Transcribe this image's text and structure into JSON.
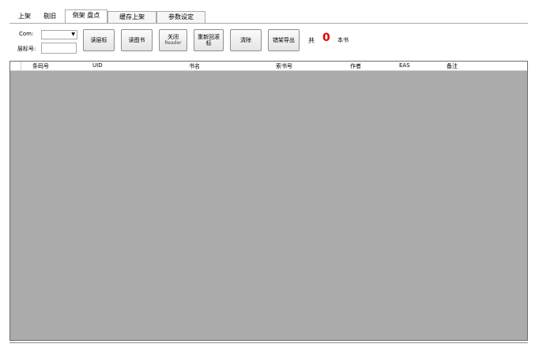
{
  "tabs": [
    "上架",
    "剔旧",
    "倒架 盘点",
    "缓存上架",
    "参数设定"
  ],
  "com_label": "Com:",
  "com_value": "",
  "shelf_label": "层标号:",
  "shelf_value": "",
  "buttons": {
    "read_shelf": "读层标",
    "read_book": "读图书",
    "close_reader_line1": "关闭",
    "close_reader_line2": "Reader",
    "reread_line1": "重新回滚",
    "reread_line2": "标",
    "clear": "清除",
    "export": "错架导出"
  },
  "count_prefix": "共",
  "count_value": "0",
  "count_suffix": "本书",
  "columns": [
    "条码号",
    "UID",
    "书名",
    "索书号",
    "作者",
    "EAS",
    "备注"
  ],
  "colors": {
    "count": "#e00000",
    "grid_bg": "#ababab"
  }
}
